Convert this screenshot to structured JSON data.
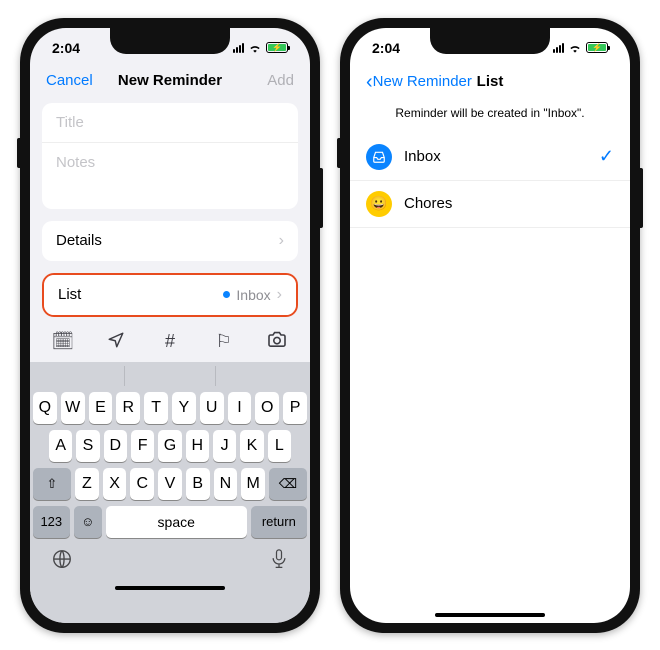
{
  "status": {
    "time": "2:04"
  },
  "left": {
    "nav": {
      "cancel": "Cancel",
      "title": "New Reminder",
      "add": "Add"
    },
    "fields": {
      "title_placeholder": "Title",
      "notes_placeholder": "Notes"
    },
    "details_label": "Details",
    "list_row": {
      "label": "List",
      "value": "Inbox"
    },
    "keyboard": {
      "row1": [
        "Q",
        "W",
        "E",
        "R",
        "T",
        "Y",
        "U",
        "I",
        "O",
        "P"
      ],
      "row2": [
        "A",
        "S",
        "D",
        "F",
        "G",
        "H",
        "J",
        "K",
        "L"
      ],
      "row3": [
        "Z",
        "X",
        "C",
        "V",
        "B",
        "N",
        "M"
      ],
      "num": "123",
      "space": "space",
      "return": "return"
    }
  },
  "right": {
    "nav": {
      "back": "New Reminder",
      "title": "List"
    },
    "subtitle": "Reminder will be created in \"Inbox\".",
    "options": [
      {
        "icon": "tray",
        "color": "bg-blue",
        "label": "Inbox",
        "selected": true
      },
      {
        "icon": "face",
        "color": "bg-yellow",
        "label": "Chores",
        "selected": false
      }
    ]
  }
}
